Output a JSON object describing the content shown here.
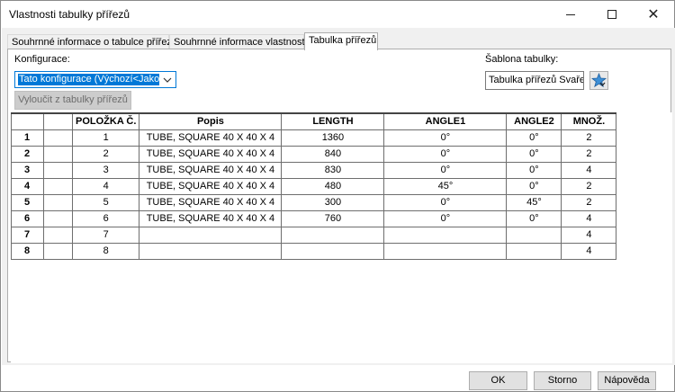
{
  "window": {
    "title": "Vlastnosti tabulky přířezů"
  },
  "tabs": [
    {
      "label": "Souhrnné informace o tabulce přířezů",
      "active": false
    },
    {
      "label": "Souhrnné informace vlastností",
      "active": false
    },
    {
      "label": "Tabulka přířezů",
      "active": true
    }
  ],
  "config": {
    "label": "Konfigurace:",
    "value": "Tato konfigurace (Výchozí<Jako ob"
  },
  "exclude_button": "Vyloučit z tabulky přířezů",
  "template": {
    "label": "Šablona tabulky:",
    "value": "Tabulka přířezů Svařen"
  },
  "table": {
    "columns": [
      "POLOŽKA Č.",
      "Popis",
      "LENGTH",
      "ANGLE1",
      "ANGLE2",
      "MNOŽ."
    ],
    "rows": [
      {
        "num": "1",
        "item": "1",
        "desc": "TUBE, SQUARE 40 X 40 X 4",
        "length": "1360",
        "angle1": "0°",
        "angle2": "0°",
        "qty": "2"
      },
      {
        "num": "2",
        "item": "2",
        "desc": "TUBE, SQUARE 40 X 40 X 4",
        "length": "840",
        "angle1": "0°",
        "angle2": "0°",
        "qty": "2"
      },
      {
        "num": "3",
        "item": "3",
        "desc": "TUBE, SQUARE 40 X 40 X 4",
        "length": "830",
        "angle1": "0°",
        "angle2": "0°",
        "qty": "4"
      },
      {
        "num": "4",
        "item": "4",
        "desc": "TUBE, SQUARE 40 X 40 X 4",
        "length": "480",
        "angle1": "45°",
        "angle2": "0°",
        "qty": "2"
      },
      {
        "num": "5",
        "item": "5",
        "desc": "TUBE, SQUARE 40 X 40 X 4",
        "length": "300",
        "angle1": "0°",
        "angle2": "45°",
        "qty": "2"
      },
      {
        "num": "6",
        "item": "6",
        "desc": "TUBE, SQUARE 40 X 40 X 4",
        "length": "760",
        "angle1": "0°",
        "angle2": "0°",
        "qty": "4"
      },
      {
        "num": "7",
        "item": "7",
        "desc": "",
        "length": "",
        "angle1": "",
        "angle2": "",
        "qty": "4"
      },
      {
        "num": "8",
        "item": "8",
        "desc": "",
        "length": "",
        "angle1": "",
        "angle2": "",
        "qty": "4"
      }
    ]
  },
  "footer": {
    "ok": "OK",
    "cancel": "Storno",
    "help": "Nápověda"
  },
  "icons": {
    "minimize": "minimize-icon",
    "maximize": "maximize-icon",
    "close": "close-icon",
    "dropdown": "chevron-down-icon",
    "template_browse": "star-template-icon"
  },
  "colors": {
    "selection": "#0078d7",
    "dialog_bg": "#f0f0f0"
  }
}
